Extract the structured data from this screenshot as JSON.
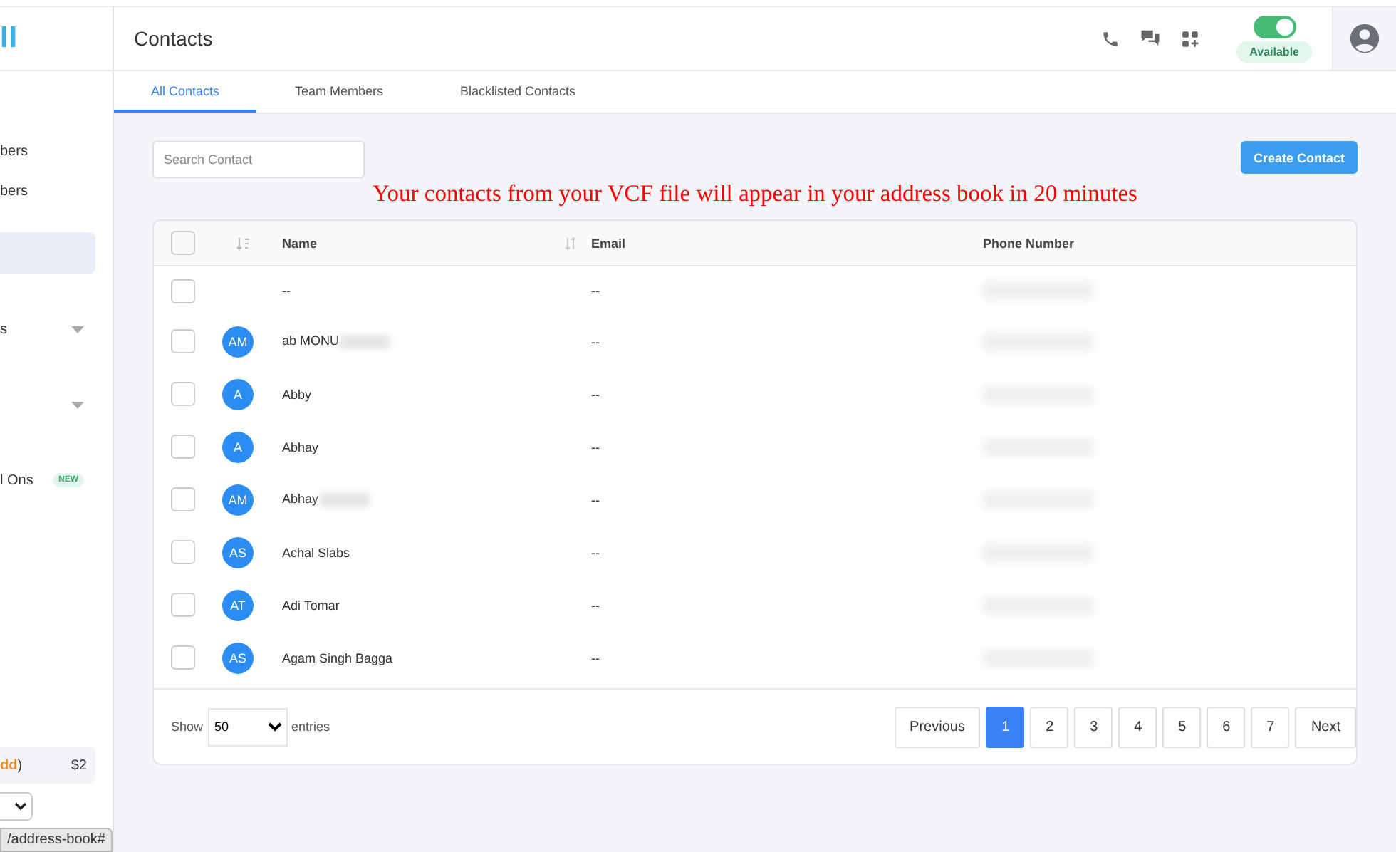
{
  "logo": {
    "text": "ll"
  },
  "sidebar": {
    "items": [
      {
        "kind": "link",
        "label": "bers",
        "selected": false
      },
      {
        "kind": "link",
        "label": "bers",
        "selected": false
      },
      {
        "kind": "link",
        "selected": true
      },
      {
        "kind": "group",
        "label": "s",
        "selected": false
      },
      {
        "kind": "group",
        "selected": false
      },
      {
        "kind": "badge",
        "label": "l Ons",
        "badge": "NEW",
        "selected": false
      }
    ],
    "credit": {
      "link": "dd",
      "suffix": ")",
      "amount": "$2"
    }
  },
  "header": {
    "title": "Contacts",
    "status": {
      "on": true,
      "label": "Available"
    }
  },
  "tabs": [
    {
      "label": "All Contacts",
      "selected": true
    },
    {
      "label": "Team Members",
      "selected": false
    },
    {
      "label": "Blacklisted Contacts",
      "selected": false
    }
  ],
  "search": {
    "placeholder": "Search Contact"
  },
  "create_button": "Create Contact",
  "notice": "Your contacts from your VCF file will appear in your address book in 20 minutes",
  "table": {
    "all_checked": false,
    "columns": [
      "Name",
      "Email",
      "Phone Number"
    ],
    "rows": [
      {
        "initials": "",
        "name": "--",
        "name_blurred": false,
        "email": "--",
        "checked": false
      },
      {
        "initials": "AM",
        "name": "ab MONU",
        "name_blurred": true,
        "email": "--",
        "checked": false
      },
      {
        "initials": "A",
        "name": "Abby",
        "name_blurred": false,
        "email": "--",
        "checked": false
      },
      {
        "initials": "A",
        "name": "Abhay",
        "name_blurred": false,
        "email": "--",
        "checked": false
      },
      {
        "initials": "AM",
        "name": "Abhay",
        "name_blurred": true,
        "email": "--",
        "checked": false
      },
      {
        "initials": "AS",
        "name": "Achal Slabs",
        "name_blurred": false,
        "email": "--",
        "checked": false
      },
      {
        "initials": "AT",
        "name": "Adi Tomar",
        "name_blurred": false,
        "email": "--",
        "checked": false
      },
      {
        "initials": "AS",
        "name": "Agam Singh Bagga",
        "name_blurred": false,
        "email": "--",
        "checked": false
      }
    ]
  },
  "footer": {
    "show": "Show",
    "entries_value": "50",
    "entries": "entries",
    "pages": [
      {
        "label": "Previous",
        "selected": false
      },
      {
        "label": "1",
        "selected": true
      },
      {
        "label": "2",
        "selected": false
      },
      {
        "label": "3",
        "selected": false
      },
      {
        "label": "4",
        "selected": false
      },
      {
        "label": "5",
        "selected": false
      },
      {
        "label": "6",
        "selected": false
      },
      {
        "label": "7",
        "selected": false
      },
      {
        "label": "Next",
        "selected": false
      }
    ]
  },
  "status_bar": "/address-book#"
}
